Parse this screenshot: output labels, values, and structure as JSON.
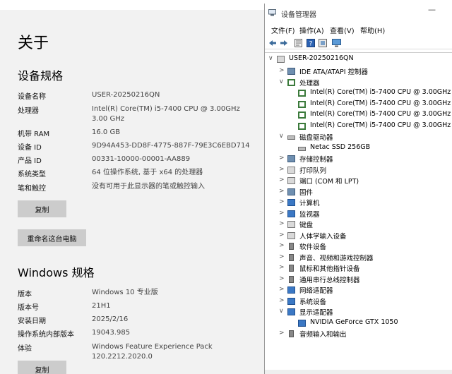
{
  "about": {
    "title": "关于",
    "device_spec_heading": "设备规格",
    "device_specs": [
      {
        "key": "设备名称",
        "value": "USER-20250216QN"
      },
      {
        "key": "处理器",
        "value": "Intel(R) Core(TM) i5-7400 CPU @ 3.00GHz   3.00 GHz"
      },
      {
        "key": "机带 RAM",
        "value": "16.0 GB"
      },
      {
        "key": "设备 ID",
        "value": "9D94A453-DD8F-4775-887F-79E3C6EBD714"
      },
      {
        "key": "产品 ID",
        "value": "00331-10000-00001-AA889"
      },
      {
        "key": "系统类型",
        "value": "64 位操作系统, 基于 x64 的处理器"
      },
      {
        "key": "笔和触控",
        "value": "没有可用于此显示器的笔或触控输入"
      }
    ],
    "copy_label": "复制",
    "rename_label": "重命名这台电脑",
    "windows_spec_heading": "Windows 规格",
    "windows_specs": [
      {
        "key": "版本",
        "value": "Windows 10 专业版"
      },
      {
        "key": "版本号",
        "value": "21H1"
      },
      {
        "key": "安装日期",
        "value": "2025/2/16"
      },
      {
        "key": "操作系统内部版本",
        "value": "19043.985"
      },
      {
        "key": "体验",
        "value": "Windows Feature Experience Pack 120.2212.2020.0"
      }
    ],
    "copy_label_2": "复制"
  },
  "device_manager": {
    "title": "设备管理器",
    "window_control": "—",
    "menu": [
      "文件(F)",
      "操作(A)",
      "查看(V)",
      "帮助(H)"
    ],
    "toolbar_icons": [
      "back-arrow-icon",
      "forward-arrow-icon",
      "properties-icon",
      "help-icon",
      "scan-icon",
      "monitor-icon"
    ],
    "expand_open": "∨",
    "expand_closed": ">",
    "tree": [
      {
        "label": "USER-20250216QN",
        "level": 0,
        "expanded": true,
        "icon": "computer-icon"
      },
      {
        "label": "IDE ATA/ATAPI 控制器",
        "level": 1,
        "expanded": false,
        "icon": "ide-controller-icon"
      },
      {
        "label": "处理器",
        "level": 1,
        "expanded": true,
        "icon": "processor-icon"
      },
      {
        "label": "Intel(R) Core(TM) i5-7400 CPU @ 3.00GHz",
        "level": 2,
        "icon": "processor-icon"
      },
      {
        "label": "Intel(R) Core(TM) i5-7400 CPU @ 3.00GHz",
        "level": 2,
        "icon": "processor-icon"
      },
      {
        "label": "Intel(R) Core(TM) i5-7400 CPU @ 3.00GHz",
        "level": 2,
        "icon": "processor-icon"
      },
      {
        "label": "Intel(R) Core(TM) i5-7400 CPU @ 3.00GHz",
        "level": 2,
        "icon": "processor-icon"
      },
      {
        "label": "磁盘驱动器",
        "level": 1,
        "expanded": true,
        "icon": "disk-drive-icon"
      },
      {
        "label": "Netac SSD 256GB",
        "level": 2,
        "icon": "disk-drive-icon"
      },
      {
        "label": "存储控制器",
        "level": 1,
        "expanded": false,
        "icon": "storage-controller-icon"
      },
      {
        "label": "打印队列",
        "level": 1,
        "expanded": false,
        "icon": "printer-icon"
      },
      {
        "label": "端口 (COM 和 LPT)",
        "level": 1,
        "expanded": false,
        "icon": "port-icon"
      },
      {
        "label": "固件",
        "level": 1,
        "expanded": false,
        "icon": "firmware-icon"
      },
      {
        "label": "计算机",
        "level": 1,
        "expanded": false,
        "icon": "computer-icon"
      },
      {
        "label": "监视器",
        "level": 1,
        "expanded": false,
        "icon": "monitor-icon"
      },
      {
        "label": "键盘",
        "level": 1,
        "expanded": false,
        "icon": "keyboard-icon"
      },
      {
        "label": "人体学输入设备",
        "level": 1,
        "expanded": false,
        "icon": "hid-icon"
      },
      {
        "label": "软件设备",
        "level": 1,
        "expanded": false,
        "icon": "software-device-icon"
      },
      {
        "label": "声音、视频和游戏控制器",
        "level": 1,
        "expanded": false,
        "icon": "sound-icon"
      },
      {
        "label": "鼠标和其他指针设备",
        "level": 1,
        "expanded": false,
        "icon": "mouse-icon"
      },
      {
        "label": "通用串行总线控制器",
        "level": 1,
        "expanded": false,
        "icon": "usb-icon"
      },
      {
        "label": "网络适配器",
        "level": 1,
        "expanded": false,
        "icon": "network-adapter-icon"
      },
      {
        "label": "系统设备",
        "level": 1,
        "expanded": false,
        "icon": "system-device-icon"
      },
      {
        "label": "显示适配器",
        "level": 1,
        "expanded": true,
        "icon": "display-adapter-icon"
      },
      {
        "label": "NVIDIA GeForce GTX 1050",
        "level": 2,
        "icon": "display-adapter-icon"
      },
      {
        "label": "音频输入和输出",
        "level": 1,
        "expanded": false,
        "icon": "audio-io-icon"
      }
    ]
  }
}
